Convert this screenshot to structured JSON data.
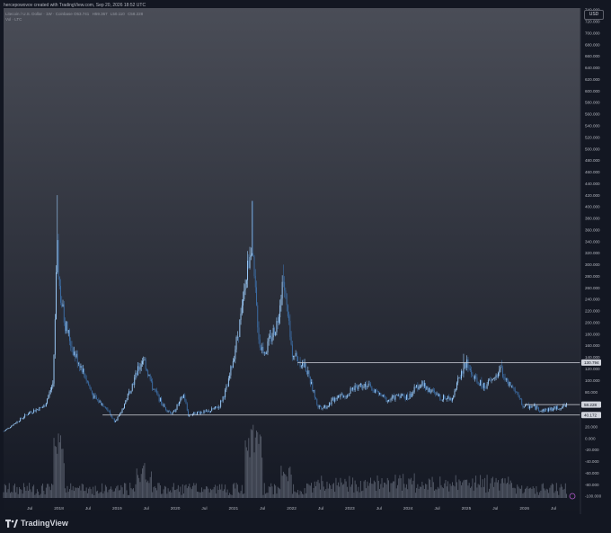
{
  "header": {
    "attribution": "hercepowovov created with TradingView.com, Sep 20, 2026 18:52 UTC",
    "symbol": "Litecoin / U.S. Dollar · 1W · Coinbase",
    "ohlc": [
      "O53.741",
      "H59.367",
      "L50.110",
      "C58.228"
    ],
    "volume_label": "Vol · LTC",
    "currency": "USD"
  },
  "brand": {
    "name": "TradingView"
  },
  "colors": {
    "background_top": "#4a4d57",
    "background_bottom": "#131722",
    "up": "#9fd0ff",
    "down": "#3d6fa8",
    "volume": "#6b7280",
    "level_line": "#d1d4dc"
  },
  "chart_data": {
    "type": "bar",
    "title": "Litecoin / U.S. Dollar · 1W · Coinbase",
    "xlabel": "",
    "ylabel": "USD",
    "ylim": [
      -100,
      740
    ],
    "y_ticks": [
      -100,
      -80,
      -60,
      -40,
      -20,
      0,
      20,
      40,
      60,
      80,
      100,
      120,
      140,
      160,
      180,
      200,
      220,
      240,
      260,
      280,
      300,
      320,
      340,
      360,
      380,
      400,
      420,
      440,
      460,
      480,
      500,
      520,
      540,
      560,
      580,
      600,
      620,
      640,
      660,
      680,
      700,
      720,
      740
    ],
    "y_tick_labels": [
      "-100.000",
      "-80.000",
      "-60.000",
      "-40.000",
      "-20.000",
      "0.000",
      "20.000",
      "40.000",
      "60.000",
      "80.000",
      "100.000",
      "120.000",
      "140.000",
      "160.000",
      "180.000",
      "200.000",
      "220.000",
      "240.000",
      "260.000",
      "280.000",
      "300.000",
      "320.000",
      "340.000",
      "360.000",
      "380.000",
      "400.000",
      "420.000",
      "440.000",
      "460.000",
      "480.000",
      "500.000",
      "520.000",
      "540.000",
      "560.000",
      "580.000",
      "600.000",
      "620.000",
      "640.000",
      "660.000",
      "680.000",
      "700.000",
      "720.000",
      "740.000"
    ],
    "x_ticks": [
      "Jul",
      "2018",
      "Jul",
      "2019",
      "Jul",
      "2020",
      "Jul",
      "2021",
      "Jul",
      "2022",
      "Jul",
      "2023",
      "Jul",
      "2024",
      "Jul",
      "2025",
      "Jul",
      "2026",
      "Jul"
    ],
    "x_tick_years": [
      2017.5,
      2018,
      2018.5,
      2019,
      2019.5,
      2020,
      2020.5,
      2021,
      2021.5,
      2022,
      2022.5,
      2023,
      2023.5,
      2024,
      2024.5,
      2025,
      2025.5,
      2026,
      2026.5
    ],
    "x_range": [
      2017.05,
      2026.9
    ],
    "price_path": [
      [
        2017.05,
        12
      ],
      [
        2017.3,
        30
      ],
      [
        2017.5,
        45
      ],
      [
        2017.75,
        55
      ],
      [
        2017.9,
        95
      ],
      [
        2017.97,
        325
      ],
      [
        2018.02,
        250
      ],
      [
        2018.1,
        200
      ],
      [
        2018.25,
        150
      ],
      [
        2018.4,
        120
      ],
      [
        2018.6,
        70
      ],
      [
        2018.8,
        55
      ],
      [
        2018.95,
        30
      ],
      [
        2019.05,
        40
      ],
      [
        2019.25,
        90
      ],
      [
        2019.45,
        140
      ],
      [
        2019.6,
        90
      ],
      [
        2019.8,
        55
      ],
      [
        2019.95,
        42
      ],
      [
        2020.15,
        75
      ],
      [
        2020.22,
        40
      ],
      [
        2020.4,
        45
      ],
      [
        2020.55,
        45
      ],
      [
        2020.75,
        55
      ],
      [
        2020.9,
        90
      ],
      [
        2021.0,
        140
      ],
      [
        2021.15,
        220
      ],
      [
        2021.3,
        340
      ],
      [
        2021.45,
        160
      ],
      [
        2021.55,
        150
      ],
      [
        2021.75,
        200
      ],
      [
        2021.85,
        280
      ],
      [
        2022.0,
        150
      ],
      [
        2022.25,
        120
      ],
      [
        2022.45,
        55
      ],
      [
        2022.6,
        55
      ],
      [
        2022.8,
        75
      ],
      [
        2022.95,
        75
      ],
      [
        2023.1,
        90
      ],
      [
        2023.25,
        95
      ],
      [
        2023.45,
        80
      ],
      [
        2023.65,
        65
      ],
      [
        2023.85,
        75
      ],
      [
        2024.0,
        70
      ],
      [
        2024.2,
        95
      ],
      [
        2024.35,
        85
      ],
      [
        2024.55,
        70
      ],
      [
        2024.75,
        70
      ],
      [
        2024.9,
        110
      ],
      [
        2025.0,
        130
      ],
      [
        2025.15,
        100
      ],
      [
        2025.3,
        90
      ],
      [
        2025.45,
        100
      ],
      [
        2025.6,
        120
      ],
      [
        2025.7,
        95
      ],
      [
        2025.85,
        80
      ],
      [
        2025.98,
        55
      ],
      [
        2026.15,
        55
      ],
      [
        2026.3,
        48
      ],
      [
        2026.55,
        52
      ],
      [
        2026.75,
        58
      ]
    ],
    "spikes": [
      [
        2017.97,
        420
      ],
      [
        2021.33,
        410
      ],
      [
        2021.85,
        300
      ],
      [
        2024.96,
        146
      ],
      [
        2025.6,
        135
      ]
    ],
    "levels": [
      {
        "value": 130.794,
        "label": "130.794",
        "x_start": 2022.1
      },
      {
        "value": 58.228,
        "label": "58.228",
        "x_start": 2026.0
      },
      {
        "value": 40.172,
        "label": "40.172",
        "x_start": 2018.75
      }
    ],
    "grid": false,
    "legend": "top-left"
  }
}
